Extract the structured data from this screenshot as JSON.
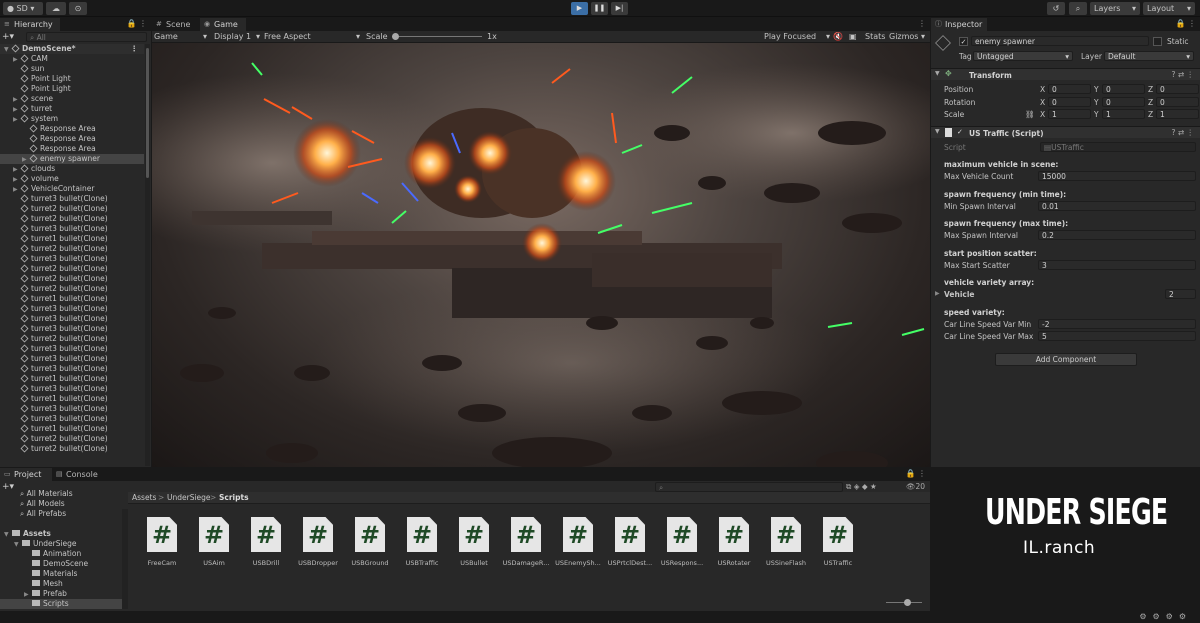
{
  "toolbar": {
    "account": "SD",
    "layers": "Layers",
    "layout": "Layout"
  },
  "hierarchy": {
    "tab": "Hierarchy",
    "search_placeholder": "All",
    "items": [
      {
        "label": "DemoScene*",
        "depth": 0,
        "arrow": true,
        "scene": true
      },
      {
        "label": "CAM",
        "depth": 1,
        "arrow": true
      },
      {
        "label": "sun",
        "depth": 1,
        "arrow": false
      },
      {
        "label": "Point Light",
        "depth": 1,
        "arrow": false
      },
      {
        "label": "Point Light",
        "depth": 1,
        "arrow": false
      },
      {
        "label": "scene",
        "depth": 1,
        "arrow": true
      },
      {
        "label": "turret",
        "depth": 1,
        "arrow": true
      },
      {
        "label": "system",
        "depth": 1,
        "arrow": true
      },
      {
        "label": "Response Area",
        "depth": 2,
        "arrow": false
      },
      {
        "label": "Response Area",
        "depth": 2,
        "arrow": false
      },
      {
        "label": "Response Area",
        "depth": 2,
        "arrow": false
      },
      {
        "label": "enemy spawner",
        "depth": 2,
        "arrow": true,
        "selected": true
      },
      {
        "label": "clouds",
        "depth": 1,
        "arrow": true
      },
      {
        "label": "volume",
        "depth": 1,
        "arrow": true
      },
      {
        "label": "VehicleContainer",
        "depth": 1,
        "arrow": true
      },
      {
        "label": "turret3 bullet(Clone)",
        "depth": 1
      },
      {
        "label": "turret2 bullet(Clone)",
        "depth": 1
      },
      {
        "label": "turret2 bullet(Clone)",
        "depth": 1
      },
      {
        "label": "turret3 bullet(Clone)",
        "depth": 1
      },
      {
        "label": "turret1 bullet(Clone)",
        "depth": 1
      },
      {
        "label": "turret2 bullet(Clone)",
        "depth": 1
      },
      {
        "label": "turret3 bullet(Clone)",
        "depth": 1
      },
      {
        "label": "turret2 bullet(Clone)",
        "depth": 1
      },
      {
        "label": "turret2 bullet(Clone)",
        "depth": 1
      },
      {
        "label": "turret2 bullet(Clone)",
        "depth": 1
      },
      {
        "label": "turret1 bullet(Clone)",
        "depth": 1
      },
      {
        "label": "turret3 bullet(Clone)",
        "depth": 1
      },
      {
        "label": "turret3 bullet(Clone)",
        "depth": 1
      },
      {
        "label": "turret3 bullet(Clone)",
        "depth": 1
      },
      {
        "label": "turret2 bullet(Clone)",
        "depth": 1
      },
      {
        "label": "turret3 bullet(Clone)",
        "depth": 1
      },
      {
        "label": "turret3 bullet(Clone)",
        "depth": 1
      },
      {
        "label": "turret3 bullet(Clone)",
        "depth": 1
      },
      {
        "label": "turret1 bullet(Clone)",
        "depth": 1
      },
      {
        "label": "turret3 bullet(Clone)",
        "depth": 1
      },
      {
        "label": "turret1 bullet(Clone)",
        "depth": 1
      },
      {
        "label": "turret3 bullet(Clone)",
        "depth": 1
      },
      {
        "label": "turret3 bullet(Clone)",
        "depth": 1
      },
      {
        "label": "turret1 bullet(Clone)",
        "depth": 1
      },
      {
        "label": "turret2 bullet(Clone)",
        "depth": 1
      },
      {
        "label": "turret2 bullet(Clone)",
        "depth": 1
      }
    ]
  },
  "view_tabs": {
    "scene": "Scene",
    "game": "Game"
  },
  "game_bar": {
    "mode": "Game",
    "display": "Display 1",
    "aspect": "Free Aspect",
    "scale_label": "Scale",
    "scale_value": "1x",
    "play_focused": "Play Focused",
    "stats": "Stats",
    "gizmos": "Gizmos"
  },
  "inspector": {
    "tab": "Inspector",
    "object_name": "enemy spawner",
    "static": "Static",
    "tag_label": "Tag",
    "tag_value": "Untagged",
    "layer_label": "Layer",
    "layer_value": "Default",
    "transform": {
      "title": "Transform",
      "rows": [
        {
          "label": "Position",
          "x": "0",
          "y": "0",
          "z": "0"
        },
        {
          "label": "Rotation",
          "x": "0",
          "y": "0",
          "z": "0"
        },
        {
          "label": "Scale",
          "x": "1",
          "y": "1",
          "z": "1"
        }
      ]
    },
    "script": {
      "title": "US Traffic (Script)",
      "script_label": "Script",
      "script_value": "USTraffic",
      "sections": [
        {
          "header": "maximum vehicle in scene:",
          "label": "Max Vehicle Count",
          "value": "15000"
        },
        {
          "header": "spawn frequency (min time):",
          "label": "Min Spawn Interval",
          "value": "0.01"
        },
        {
          "header": "spawn frequency (max time):",
          "label": "Max Spawn Interval",
          "value": "0.2"
        },
        {
          "header": "start position scatter:",
          "label": "Max Start Scatter",
          "value": "3"
        },
        {
          "header": "vehicle variety array:",
          "label": "Vehicle",
          "value": "2"
        }
      ],
      "speed_header": "speed variety:",
      "speed_rows": [
        {
          "label": "Car Line Speed Var Min",
          "value": "-2"
        },
        {
          "label": "Car Line Speed Var Max",
          "value": "5"
        }
      ]
    },
    "add_component": "Add Component"
  },
  "project": {
    "tab_project": "Project",
    "tab_console": "Console",
    "favorites": [
      "All Materials",
      "All Models",
      "All Prefabs"
    ],
    "tree": [
      {
        "label": "Assets",
        "depth": 0,
        "bold": true
      },
      {
        "label": "UnderSiege",
        "depth": 1
      },
      {
        "label": "Animation",
        "depth": 2
      },
      {
        "label": "DemoScene",
        "depth": 2
      },
      {
        "label": "Materials",
        "depth": 2
      },
      {
        "label": "Mesh",
        "depth": 2
      },
      {
        "label": "Prefab",
        "depth": 2
      },
      {
        "label": "Scripts",
        "depth": 2,
        "selected": true
      }
    ],
    "breadcrumb": [
      "Assets",
      "UnderSiege",
      "Scripts"
    ],
    "count": "20",
    "assets": [
      "FreeCam",
      "USAim",
      "USBDrill",
      "USBDropper",
      "USBGround",
      "USBTraffic",
      "USBullet",
      "USDamageR...",
      "USEnemySh...",
      "USPrtclDest...",
      "USRespons...",
      "USRotater",
      "USSineFlash",
      "USTraffic"
    ]
  },
  "branding": {
    "title": "UNDER SIEGE",
    "subtitle": "IL.ranch"
  }
}
